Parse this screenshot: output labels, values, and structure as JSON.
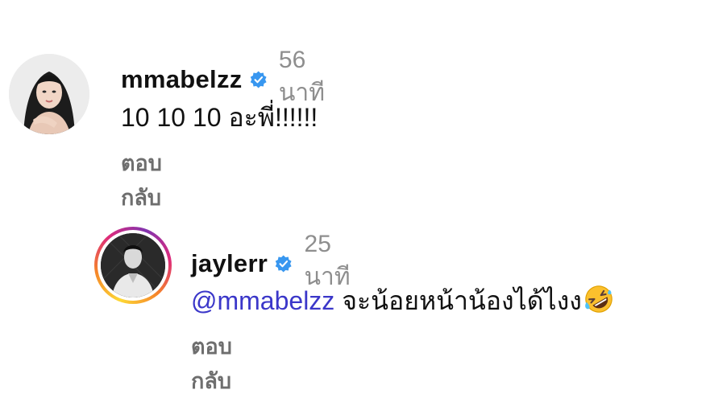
{
  "comments": [
    {
      "username": "mmabelzz",
      "verified": true,
      "time": "56 นาที",
      "text": "10 10 10 อะพี่!!!!!!",
      "reply_label": "ตอบกลับ",
      "avatar_icon": "profile-photo"
    },
    {
      "username": "jaylerr",
      "verified": true,
      "time": "25 นาที",
      "mention": "@mmabelzz",
      "text": " จะน้อยหน้าน้องได้ไงง",
      "emoji": "rolling-on-the-floor-laughing-emoji",
      "reply_label": "ตอบกลับ",
      "avatar_icon": "profile-photo-story-ring"
    }
  ],
  "colors": {
    "verified_badge": "#3897f0",
    "mention": "#3b37c9",
    "muted": "#8e8e8e",
    "reply": "#6e6e6e"
  }
}
